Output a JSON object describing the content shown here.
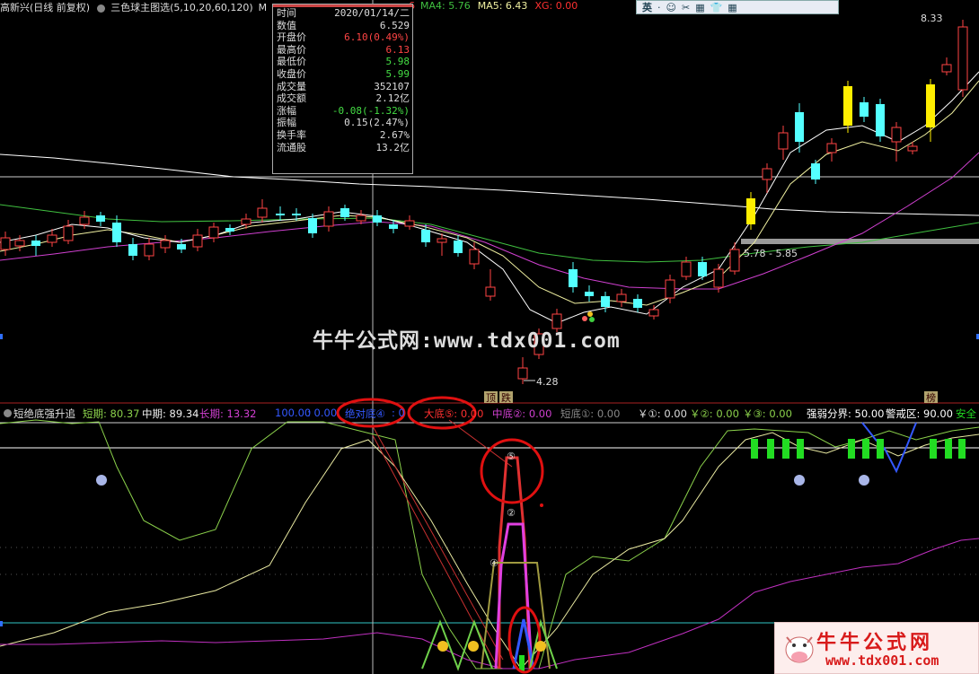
{
  "header": {
    "stock": "高新兴(日线 前复权)",
    "formula": "三色球主图选(5,10,20,60,120)",
    "ma_tail": "M",
    "ma4_label": "MA4: 5.76",
    "ma5_label": "MA5: 6.43",
    "xg_label": "XG: 0.00",
    "stray_num": "6"
  },
  "toolbar": {
    "lang": "英",
    "items": [
      "·",
      "☺",
      "✂",
      "▦",
      "👕",
      "▦"
    ]
  },
  "tooltip": {
    "rows": [
      {
        "k": "时间",
        "v": "2020/01/14/二",
        "c": "#dddddd"
      },
      {
        "k": "数值",
        "v": "6.529",
        "c": "#dddddd"
      },
      {
        "k": "开盘价",
        "v": "6.10(0.49%)",
        "c": "#ff4444"
      },
      {
        "k": "最高价",
        "v": "6.13",
        "c": "#ff4444"
      },
      {
        "k": "最低价",
        "v": "5.98",
        "c": "#44dd44"
      },
      {
        "k": "收盘价",
        "v": "5.99",
        "c": "#44dd44"
      },
      {
        "k": "成交量",
        "v": "352107",
        "c": "#dddddd"
      },
      {
        "k": "成交额",
        "v": "2.12亿",
        "c": "#dddddd"
      },
      {
        "k": "涨幅",
        "v": "-0.08(-1.32%)",
        "c": "#44dd44"
      },
      {
        "k": "振幅",
        "v": "0.15(2.47%)",
        "c": "#dddddd"
      },
      {
        "k": "换手率",
        "v": "2.67%",
        "c": "#dddddd"
      },
      {
        "k": "流通股",
        "v": "13.2亿",
        "c": "#dddddd"
      }
    ]
  },
  "main": {
    "high_label": "8.33",
    "low_label": "4.28",
    "range_label": "5.78 - 5.85",
    "watermark": "牛牛公式网:www.tdx001.com",
    "marker_up": "顶",
    "marker_down": "跌",
    "marker_right": "榜"
  },
  "indicator": {
    "name": "短绝底强升追",
    "short": "短期: 80.37",
    "mid": "中期: 89.34",
    "long": "长期: 13.32",
    "v100": "100.00",
    "abs_low": "绝对底④",
    "big_low": "大底⑤: 0.00",
    "mid_low": "中底②: 0.00",
    "short_low": "短底①: 0.00",
    "y1": "￥①: 0.00",
    "y2": "￥②: 0.00",
    "y3": "￥③: 0.00",
    "strong": "强弱分界: 50.00",
    "alert": "警戒区: 90.00",
    "safe": "安全",
    "zero1": ": 0.00",
    "zero2": ": 0",
    "num5": "⑤",
    "num2": "②",
    "num4": "④"
  },
  "logo": {
    "title": "牛牛公式网",
    "url": "www.tdx001.com"
  },
  "colors": {
    "up": "#ff4444",
    "down": "#54ffff",
    "yellow": "#ffee00",
    "ma_white": "#ffffff",
    "ma_yellow": "#f0f0a0",
    "ma_purple": "#d040d0",
    "ma_green": "#40c040",
    "cyan_line": "#2fc6c6"
  }
}
